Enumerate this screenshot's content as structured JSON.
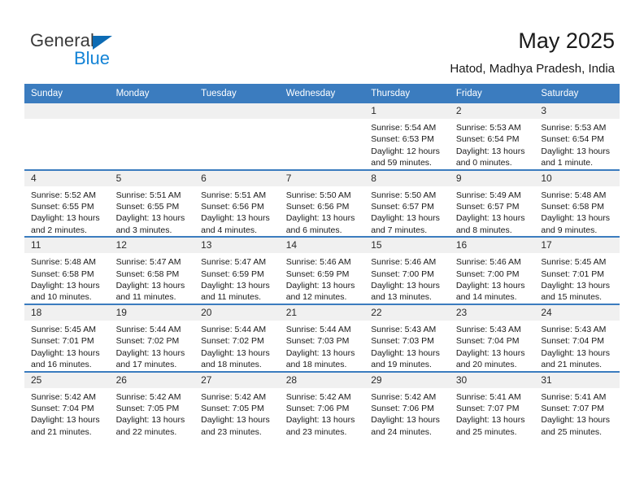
{
  "brand": {
    "name_part1": "General",
    "name_part2": "Blue",
    "accent_color": "#1383d6",
    "triangle_color": "#0d6bb4"
  },
  "header": {
    "title": "May 2025",
    "subtitle": "Hatod, Madhya Pradesh, India"
  },
  "calendar": {
    "header_color": "#3b7cbf",
    "weekday_headers": [
      "Sunday",
      "Monday",
      "Tuesday",
      "Wednesday",
      "Thursday",
      "Friday",
      "Saturday"
    ],
    "weeks": [
      [
        {
          "day": "",
          "empty": true
        },
        {
          "day": "",
          "empty": true
        },
        {
          "day": "",
          "empty": true
        },
        {
          "day": "",
          "empty": true
        },
        {
          "day": "1",
          "sunrise": "Sunrise: 5:54 AM",
          "sunset": "Sunset: 6:53 PM",
          "daylight_line1": "Daylight: 12 hours",
          "daylight_line2": "and 59 minutes."
        },
        {
          "day": "2",
          "sunrise": "Sunrise: 5:53 AM",
          "sunset": "Sunset: 6:54 PM",
          "daylight_line1": "Daylight: 13 hours",
          "daylight_line2": "and 0 minutes."
        },
        {
          "day": "3",
          "sunrise": "Sunrise: 5:53 AM",
          "sunset": "Sunset: 6:54 PM",
          "daylight_line1": "Daylight: 13 hours",
          "daylight_line2": "and 1 minute."
        }
      ],
      [
        {
          "day": "4",
          "sunrise": "Sunrise: 5:52 AM",
          "sunset": "Sunset: 6:55 PM",
          "daylight_line1": "Daylight: 13 hours",
          "daylight_line2": "and 2 minutes."
        },
        {
          "day": "5",
          "sunrise": "Sunrise: 5:51 AM",
          "sunset": "Sunset: 6:55 PM",
          "daylight_line1": "Daylight: 13 hours",
          "daylight_line2": "and 3 minutes."
        },
        {
          "day": "6",
          "sunrise": "Sunrise: 5:51 AM",
          "sunset": "Sunset: 6:56 PM",
          "daylight_line1": "Daylight: 13 hours",
          "daylight_line2": "and 4 minutes."
        },
        {
          "day": "7",
          "sunrise": "Sunrise: 5:50 AM",
          "sunset": "Sunset: 6:56 PM",
          "daylight_line1": "Daylight: 13 hours",
          "daylight_line2": "and 6 minutes."
        },
        {
          "day": "8",
          "sunrise": "Sunrise: 5:50 AM",
          "sunset": "Sunset: 6:57 PM",
          "daylight_line1": "Daylight: 13 hours",
          "daylight_line2": "and 7 minutes."
        },
        {
          "day": "9",
          "sunrise": "Sunrise: 5:49 AM",
          "sunset": "Sunset: 6:57 PM",
          "daylight_line1": "Daylight: 13 hours",
          "daylight_line2": "and 8 minutes."
        },
        {
          "day": "10",
          "sunrise": "Sunrise: 5:48 AM",
          "sunset": "Sunset: 6:58 PM",
          "daylight_line1": "Daylight: 13 hours",
          "daylight_line2": "and 9 minutes."
        }
      ],
      [
        {
          "day": "11",
          "sunrise": "Sunrise: 5:48 AM",
          "sunset": "Sunset: 6:58 PM",
          "daylight_line1": "Daylight: 13 hours",
          "daylight_line2": "and 10 minutes."
        },
        {
          "day": "12",
          "sunrise": "Sunrise: 5:47 AM",
          "sunset": "Sunset: 6:58 PM",
          "daylight_line1": "Daylight: 13 hours",
          "daylight_line2": "and 11 minutes."
        },
        {
          "day": "13",
          "sunrise": "Sunrise: 5:47 AM",
          "sunset": "Sunset: 6:59 PM",
          "daylight_line1": "Daylight: 13 hours",
          "daylight_line2": "and 11 minutes."
        },
        {
          "day": "14",
          "sunrise": "Sunrise: 5:46 AM",
          "sunset": "Sunset: 6:59 PM",
          "daylight_line1": "Daylight: 13 hours",
          "daylight_line2": "and 12 minutes."
        },
        {
          "day": "15",
          "sunrise": "Sunrise: 5:46 AM",
          "sunset": "Sunset: 7:00 PM",
          "daylight_line1": "Daylight: 13 hours",
          "daylight_line2": "and 13 minutes."
        },
        {
          "day": "16",
          "sunrise": "Sunrise: 5:46 AM",
          "sunset": "Sunset: 7:00 PM",
          "daylight_line1": "Daylight: 13 hours",
          "daylight_line2": "and 14 minutes."
        },
        {
          "day": "17",
          "sunrise": "Sunrise: 5:45 AM",
          "sunset": "Sunset: 7:01 PM",
          "daylight_line1": "Daylight: 13 hours",
          "daylight_line2": "and 15 minutes."
        }
      ],
      [
        {
          "day": "18",
          "sunrise": "Sunrise: 5:45 AM",
          "sunset": "Sunset: 7:01 PM",
          "daylight_line1": "Daylight: 13 hours",
          "daylight_line2": "and 16 minutes."
        },
        {
          "day": "19",
          "sunrise": "Sunrise: 5:44 AM",
          "sunset": "Sunset: 7:02 PM",
          "daylight_line1": "Daylight: 13 hours",
          "daylight_line2": "and 17 minutes."
        },
        {
          "day": "20",
          "sunrise": "Sunrise: 5:44 AM",
          "sunset": "Sunset: 7:02 PM",
          "daylight_line1": "Daylight: 13 hours",
          "daylight_line2": "and 18 minutes."
        },
        {
          "day": "21",
          "sunrise": "Sunrise: 5:44 AM",
          "sunset": "Sunset: 7:03 PM",
          "daylight_line1": "Daylight: 13 hours",
          "daylight_line2": "and 18 minutes."
        },
        {
          "day": "22",
          "sunrise": "Sunrise: 5:43 AM",
          "sunset": "Sunset: 7:03 PM",
          "daylight_line1": "Daylight: 13 hours",
          "daylight_line2": "and 19 minutes."
        },
        {
          "day": "23",
          "sunrise": "Sunrise: 5:43 AM",
          "sunset": "Sunset: 7:04 PM",
          "daylight_line1": "Daylight: 13 hours",
          "daylight_line2": "and 20 minutes."
        },
        {
          "day": "24",
          "sunrise": "Sunrise: 5:43 AM",
          "sunset": "Sunset: 7:04 PM",
          "daylight_line1": "Daylight: 13 hours",
          "daylight_line2": "and 21 minutes."
        }
      ],
      [
        {
          "day": "25",
          "sunrise": "Sunrise: 5:42 AM",
          "sunset": "Sunset: 7:04 PM",
          "daylight_line1": "Daylight: 13 hours",
          "daylight_line2": "and 21 minutes."
        },
        {
          "day": "26",
          "sunrise": "Sunrise: 5:42 AM",
          "sunset": "Sunset: 7:05 PM",
          "daylight_line1": "Daylight: 13 hours",
          "daylight_line2": "and 22 minutes."
        },
        {
          "day": "27",
          "sunrise": "Sunrise: 5:42 AM",
          "sunset": "Sunset: 7:05 PM",
          "daylight_line1": "Daylight: 13 hours",
          "daylight_line2": "and 23 minutes."
        },
        {
          "day": "28",
          "sunrise": "Sunrise: 5:42 AM",
          "sunset": "Sunset: 7:06 PM",
          "daylight_line1": "Daylight: 13 hours",
          "daylight_line2": "and 23 minutes."
        },
        {
          "day": "29",
          "sunrise": "Sunrise: 5:42 AM",
          "sunset": "Sunset: 7:06 PM",
          "daylight_line1": "Daylight: 13 hours",
          "daylight_line2": "and 24 minutes."
        },
        {
          "day": "30",
          "sunrise": "Sunrise: 5:41 AM",
          "sunset": "Sunset: 7:07 PM",
          "daylight_line1": "Daylight: 13 hours",
          "daylight_line2": "and 25 minutes."
        },
        {
          "day": "31",
          "sunrise": "Sunrise: 5:41 AM",
          "sunset": "Sunset: 7:07 PM",
          "daylight_line1": "Daylight: 13 hours",
          "daylight_line2": "and 25 minutes."
        }
      ]
    ]
  }
}
